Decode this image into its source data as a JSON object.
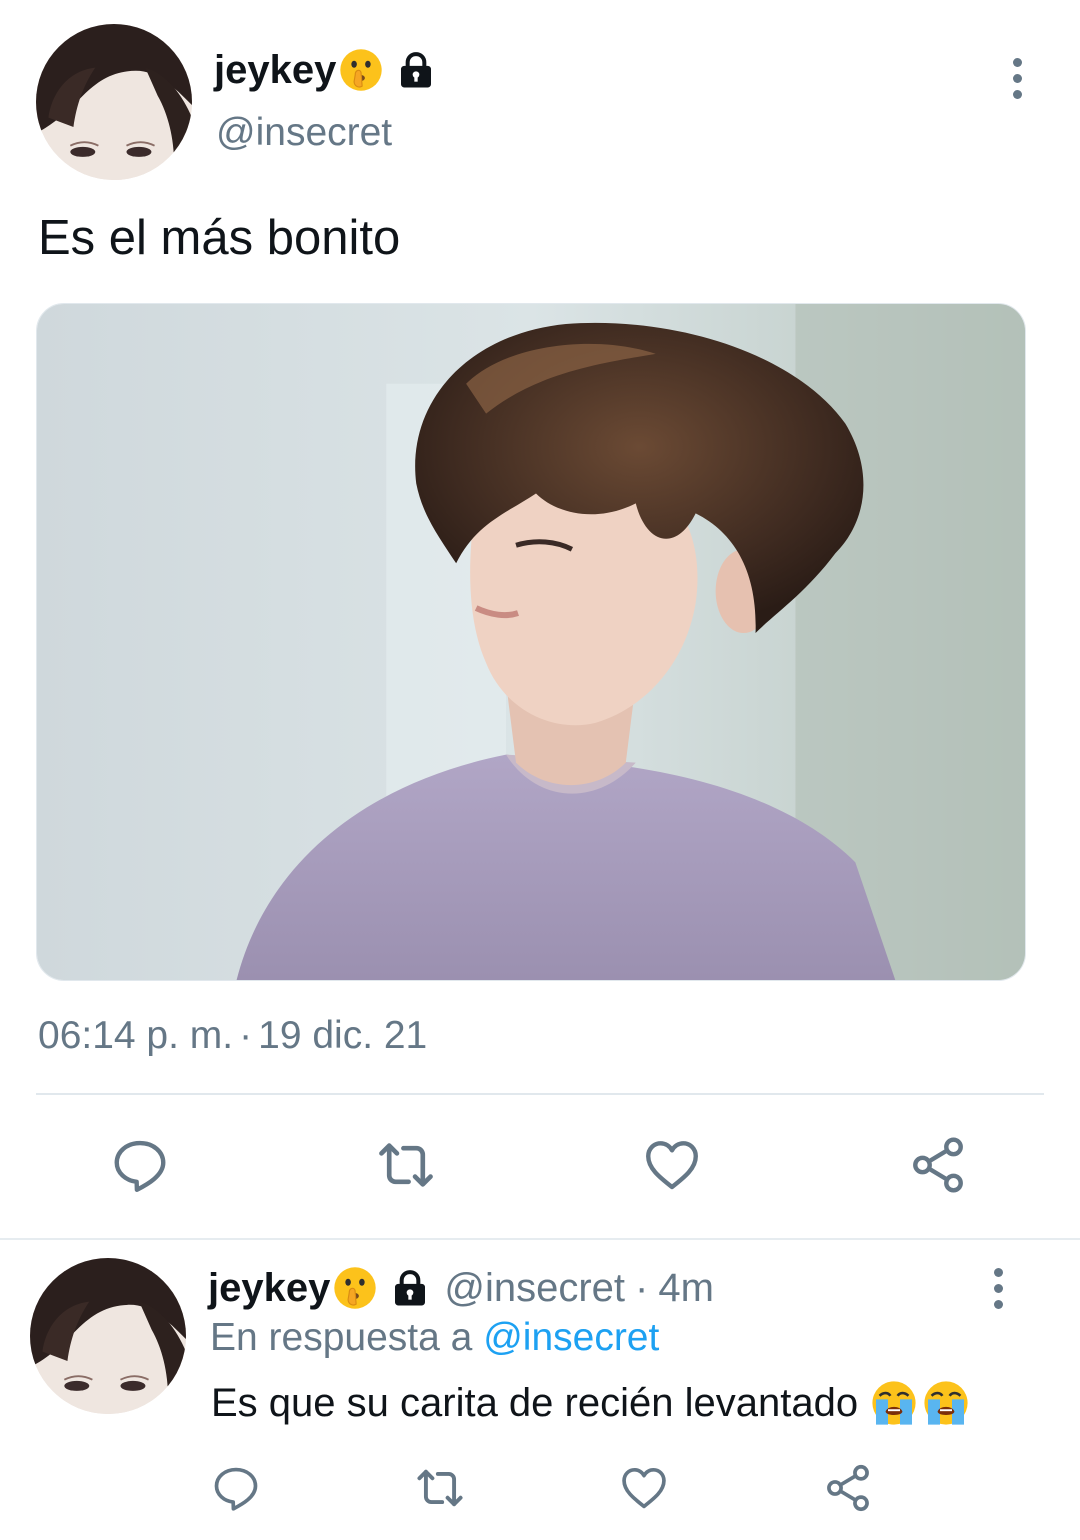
{
  "main_tweet": {
    "author_name": "jeykey",
    "author_handle": "@insecret",
    "text": "Es el más bonito",
    "time": "06:14 p. m.",
    "separator": "·",
    "date": "19 dic. 21",
    "icons": {
      "name_emoji": "shushing-face-emoji",
      "protected": "lock-icon",
      "menu": "more-vertical-icon"
    },
    "actions": [
      "reply-icon",
      "retweet-icon",
      "like-icon",
      "share-icon"
    ]
  },
  "reply": {
    "author_name": "jeykey",
    "author_handle": "@insecret",
    "separator": "·",
    "time_ago": "4m",
    "reply_prefix": "En respuesta a",
    "reply_to": "@insecret",
    "text": "Es que su carita de recién levantado",
    "text_emojis": "loudly-crying-face x2",
    "actions": [
      "reply-icon",
      "retweet-icon",
      "like-icon",
      "share-icon"
    ]
  },
  "colors": {
    "text": "#0f1419",
    "secondary": "#657786",
    "link": "#1da1f2",
    "divider": "#e1e8ed"
  }
}
